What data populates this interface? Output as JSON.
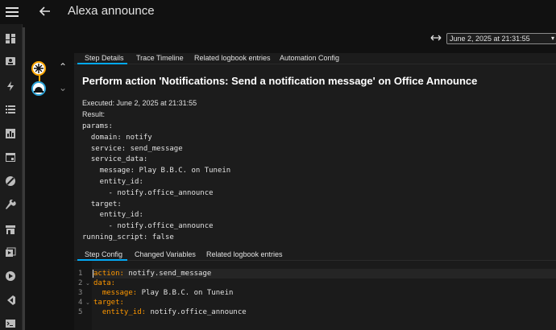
{
  "app": {
    "title": "Alexa announce"
  },
  "toolbar": {
    "timestamp": "June 2, 2025 at 21:31:55"
  },
  "trace_tabs": [
    {
      "label": "Step Details"
    },
    {
      "label": "Trace Timeline"
    },
    {
      "label": "Related logbook entries"
    },
    {
      "label": "Automation Config"
    }
  ],
  "step": {
    "heading": "Perform action 'Notifications: Send a notification message' on Office Announce",
    "executed": "Executed: June 2, 2025 at 21:31:55",
    "result_label": "Result:",
    "result_lines": [
      "params:",
      "  domain: notify",
      "  service: send_message",
      "  service_data:",
      "    message: Play B.B.C. on Tunein",
      "    entity_id:",
      "      - notify.office_announce",
      "  target:",
      "    entity_id:",
      "      - notify.office_announce",
      "running_script: false"
    ]
  },
  "step_tabs": [
    {
      "label": "Step Config"
    },
    {
      "label": "Changed Variables"
    },
    {
      "label": "Related logbook entries"
    }
  ],
  "editor": {
    "lines": [
      {
        "num": "1",
        "key": "action:",
        "value": " notify.send_message",
        "indent": ""
      },
      {
        "num": "2",
        "key": "data:",
        "value": "",
        "indent": ""
      },
      {
        "num": "3",
        "key": "message:",
        "value": " Play B.B.C. on Tunein",
        "indent": "  "
      },
      {
        "num": "4",
        "key": "target:",
        "value": "",
        "indent": ""
      },
      {
        "num": "5",
        "key": "entity_id:",
        "value": " notify.office_announce",
        "indent": "  "
      }
    ]
  },
  "icons": {
    "menu": "menu-icon",
    "back": "arrow-left-icon",
    "sidebar": [
      "dashboard-icon",
      "person-icon",
      "lightning-icon",
      "list-icon",
      "chart-icon",
      "calendar-icon",
      "cancel-icon",
      "wrench-icon",
      "store-icon",
      "playlist-icon",
      "play-circle-icon",
      "vscode-icon",
      "terminal-icon"
    ],
    "expand": "expand-horizontal-icon",
    "collapse": "collapse-horizontal-icon"
  },
  "colors": {
    "accent": "#03a9f4",
    "trigger": "#ffa600",
    "action": "#2ba3d8",
    "yaml_key": "#ff9800"
  }
}
